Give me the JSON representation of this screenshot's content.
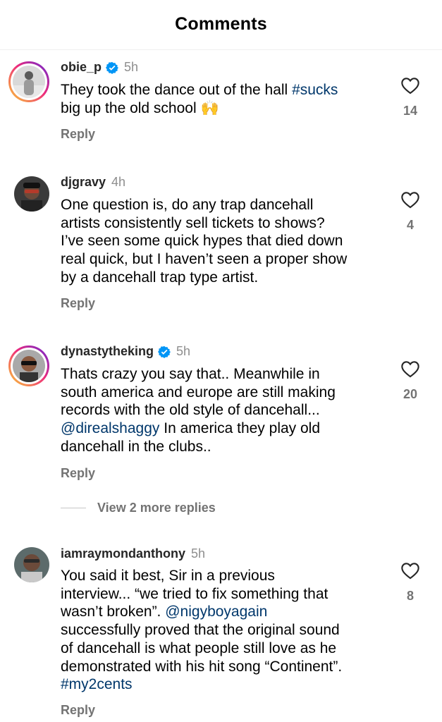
{
  "header": {
    "title": "Comments"
  },
  "comments": [
    {
      "username": "obie_p",
      "verified": true,
      "time": "5h",
      "lines": [
        [
          {
            "t": "They took the dance out of the hall "
          },
          {
            "t": "#sucks",
            "link": true
          }
        ],
        [
          {
            "t": "big up the old school 🙌"
          }
        ]
      ],
      "reply_label": "Reply",
      "likes": "14"
    },
    {
      "username": "djgravy",
      "verified": false,
      "time": "4h",
      "lines": [
        [
          {
            "t": "One question is, do any trap dancehall"
          }
        ],
        [
          {
            "t": "artists consistently sell tickets to shows?"
          }
        ],
        [
          {
            "t": "I’ve seen some quick hypes that died down"
          }
        ],
        [
          {
            "t": "real quick, but I haven’t seen a proper show"
          }
        ],
        [
          {
            "t": "by a dancehall trap type artist."
          }
        ]
      ],
      "reply_label": "Reply",
      "likes": "4"
    },
    {
      "username": "dynastytheking",
      "verified": true,
      "time": "5h",
      "lines": [
        [
          {
            "t": "Thats crazy you say that.. Meanwhile in"
          }
        ],
        [
          {
            "t": "south america and europe are still making"
          }
        ],
        [
          {
            "t": "records with the old style of dancehall..."
          }
        ],
        [
          {
            "t": "@direalshaggy",
            "link": true
          },
          {
            "t": " In america they play old"
          }
        ],
        [
          {
            "t": "dancehall in the clubs.."
          }
        ]
      ],
      "reply_label": "Reply",
      "likes": "20"
    },
    {
      "username": "iamraymondanthony",
      "verified": false,
      "time": "5h",
      "lines": [
        [
          {
            "t": "You said it best, Sir in a previous"
          }
        ],
        [
          {
            "t": "interview... “we tried to fix something that"
          }
        ],
        [
          {
            "t": "wasn’t broken”. "
          },
          {
            "t": "@nigyboyagain",
            "link": true
          }
        ],
        [
          {
            "t": "successfully proved that the original sound"
          }
        ],
        [
          {
            "t": "of dancehall is what people still love as he"
          }
        ],
        [
          {
            "t": "demonstrated with his hit song “Continent”."
          }
        ],
        [
          {
            "t": "#my2cents",
            "link": true
          }
        ]
      ],
      "reply_label": "Reply",
      "likes": "8"
    }
  ],
  "view_more": {
    "label": "View 2 more replies"
  },
  "colors": {
    "link": "#00376b",
    "muted": "#737373",
    "verified": "#0095f6"
  }
}
